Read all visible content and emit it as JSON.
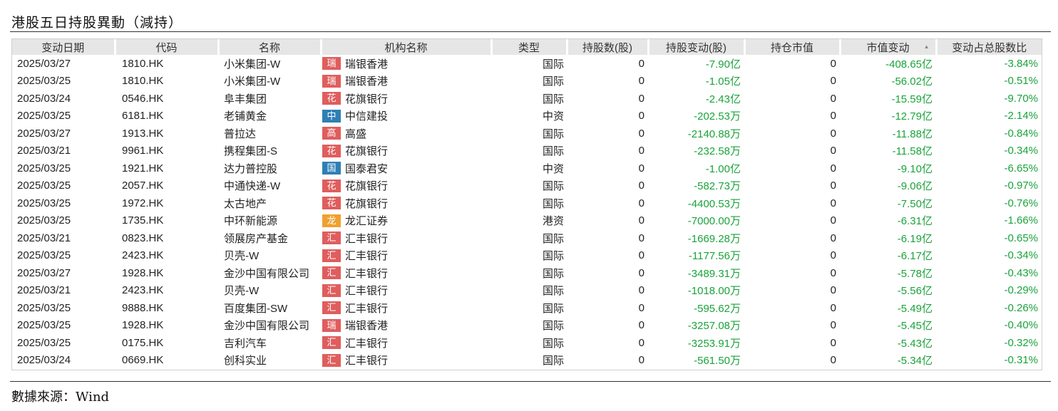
{
  "title": "港股五日持股異動（減持）",
  "source": "數據來源：Wind",
  "colors": {
    "negative": "#1aa33b",
    "header_bg": "#e6e6e6"
  },
  "columns": [
    "变动日期",
    "代码",
    "名称",
    "机构名称",
    "类型",
    "持股数(股)",
    "持股变动(股)",
    "持仓市值",
    "市值变动",
    "变动占总股数比"
  ],
  "sort_icon": "▲",
  "badge_colors": {
    "瑞": "#e05d5d",
    "花": "#e05d5d",
    "中": "#2f7fb5",
    "高": "#e05d5d",
    "国": "#2f7fb5",
    "龙": "#f0a030",
    "汇": "#e05d5d"
  },
  "rows": [
    {
      "date": "2025/03/27",
      "code": "1810.HK",
      "name": "小米集团-W",
      "badge": "瑞",
      "inst": "瑞银香港",
      "type": "国际",
      "shares": "0",
      "change": "-7.90亿",
      "mv": "0",
      "mv_change": "-408.65亿",
      "ratio": "-3.84%"
    },
    {
      "date": "2025/03/25",
      "code": "1810.HK",
      "name": "小米集团-W",
      "badge": "瑞",
      "inst": "瑞银香港",
      "type": "国际",
      "shares": "0",
      "change": "-1.05亿",
      "mv": "0",
      "mv_change": "-56.02亿",
      "ratio": "-0.51%"
    },
    {
      "date": "2025/03/24",
      "code": "0546.HK",
      "name": "阜丰集团",
      "badge": "花",
      "inst": "花旗银行",
      "type": "国际",
      "shares": "0",
      "change": "-2.43亿",
      "mv": "0",
      "mv_change": "-15.59亿",
      "ratio": "-9.70%"
    },
    {
      "date": "2025/03/25",
      "code": "6181.HK",
      "name": "老铺黄金",
      "badge": "中",
      "inst": "中信建投",
      "type": "中资",
      "shares": "0",
      "change": "-202.53万",
      "mv": "0",
      "mv_change": "-12.79亿",
      "ratio": "-2.14%"
    },
    {
      "date": "2025/03/27",
      "code": "1913.HK",
      "name": "普拉达",
      "badge": "高",
      "inst": "高盛",
      "type": "国际",
      "shares": "0",
      "change": "-2140.88万",
      "mv": "0",
      "mv_change": "-11.88亿",
      "ratio": "-0.84%"
    },
    {
      "date": "2025/03/21",
      "code": "9961.HK",
      "name": "携程集团-S",
      "badge": "花",
      "inst": "花旗银行",
      "type": "国际",
      "shares": "0",
      "change": "-232.58万",
      "mv": "0",
      "mv_change": "-11.58亿",
      "ratio": "-0.34%"
    },
    {
      "date": "2025/03/25",
      "code": "1921.HK",
      "name": "达力普控股",
      "badge": "国",
      "inst": "国泰君安",
      "type": "中资",
      "shares": "0",
      "change": "-1.00亿",
      "mv": "0",
      "mv_change": "-9.10亿",
      "ratio": "-6.65%"
    },
    {
      "date": "2025/03/25",
      "code": "2057.HK",
      "name": "中通快递-W",
      "badge": "花",
      "inst": "花旗银行",
      "type": "国际",
      "shares": "0",
      "change": "-582.73万",
      "mv": "0",
      "mv_change": "-9.06亿",
      "ratio": "-0.97%"
    },
    {
      "date": "2025/03/25",
      "code": "1972.HK",
      "name": "太古地产",
      "badge": "花",
      "inst": "花旗银行",
      "type": "国际",
      "shares": "0",
      "change": "-4400.53万",
      "mv": "0",
      "mv_change": "-7.50亿",
      "ratio": "-0.76%"
    },
    {
      "date": "2025/03/25",
      "code": "1735.HK",
      "name": "中环新能源",
      "badge": "龙",
      "inst": "龙汇证券",
      "type": "港资",
      "shares": "0",
      "change": "-7000.00万",
      "mv": "0",
      "mv_change": "-6.31亿",
      "ratio": "-1.66%"
    },
    {
      "date": "2025/03/21",
      "code": "0823.HK",
      "name": "领展房产基金",
      "badge": "汇",
      "inst": "汇丰银行",
      "type": "国际",
      "shares": "0",
      "change": "-1669.28万",
      "mv": "0",
      "mv_change": "-6.19亿",
      "ratio": "-0.65%"
    },
    {
      "date": "2025/03/25",
      "code": "2423.HK",
      "name": "贝壳-W",
      "badge": "汇",
      "inst": "汇丰银行",
      "type": "国际",
      "shares": "0",
      "change": "-1177.56万",
      "mv": "0",
      "mv_change": "-6.17亿",
      "ratio": "-0.34%"
    },
    {
      "date": "2025/03/27",
      "code": "1928.HK",
      "name": "金沙中国有限公司",
      "badge": "汇",
      "inst": "汇丰银行",
      "type": "国际",
      "shares": "0",
      "change": "-3489.31万",
      "mv": "0",
      "mv_change": "-5.78亿",
      "ratio": "-0.43%"
    },
    {
      "date": "2025/03/21",
      "code": "2423.HK",
      "name": "贝壳-W",
      "badge": "汇",
      "inst": "汇丰银行",
      "type": "国际",
      "shares": "0",
      "change": "-1018.00万",
      "mv": "0",
      "mv_change": "-5.56亿",
      "ratio": "-0.29%"
    },
    {
      "date": "2025/03/25",
      "code": "9888.HK",
      "name": "百度集团-SW",
      "badge": "汇",
      "inst": "汇丰银行",
      "type": "国际",
      "shares": "0",
      "change": "-595.62万",
      "mv": "0",
      "mv_change": "-5.49亿",
      "ratio": "-0.26%"
    },
    {
      "date": "2025/03/25",
      "code": "1928.HK",
      "name": "金沙中国有限公司",
      "badge": "瑞",
      "inst": "瑞银香港",
      "type": "国际",
      "shares": "0",
      "change": "-3257.08万",
      "mv": "0",
      "mv_change": "-5.45亿",
      "ratio": "-0.40%"
    },
    {
      "date": "2025/03/25",
      "code": "0175.HK",
      "name": "吉利汽车",
      "badge": "汇",
      "inst": "汇丰银行",
      "type": "国际",
      "shares": "0",
      "change": "-3253.91万",
      "mv": "0",
      "mv_change": "-5.43亿",
      "ratio": "-0.32%"
    },
    {
      "date": "2025/03/24",
      "code": "0669.HK",
      "name": "创科实业",
      "badge": "汇",
      "inst": "汇丰银行",
      "type": "国际",
      "shares": "0",
      "change": "-561.50万",
      "mv": "0",
      "mv_change": "-5.34亿",
      "ratio": "-0.31%"
    }
  ]
}
